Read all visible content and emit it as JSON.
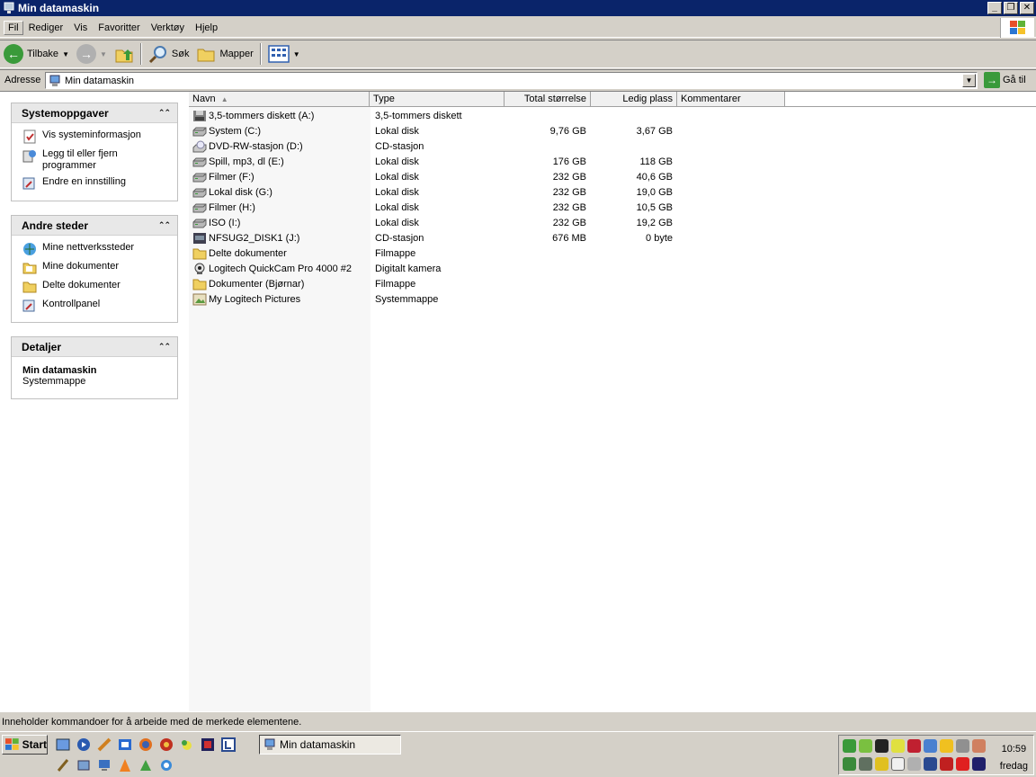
{
  "window": {
    "title": "Min datamaskin"
  },
  "menu": [
    "Fil",
    "Rediger",
    "Vis",
    "Favoritter",
    "Verktøy",
    "Hjelp"
  ],
  "toolbar": {
    "back": "Tilbake",
    "search": "Søk",
    "folders": "Mapper"
  },
  "address": {
    "label": "Adresse",
    "value": "Min datamaskin",
    "go": "Gå til"
  },
  "taskpane": {
    "system": {
      "title": "Systemoppgaver",
      "links": [
        "Vis systeminformasjon",
        "Legg til eller fjern programmer",
        "Endre en innstilling"
      ]
    },
    "other": {
      "title": "Andre steder",
      "links": [
        "Mine nettverkssteder",
        "Mine dokumenter",
        "Delte dokumenter",
        "Kontrollpanel"
      ]
    },
    "details": {
      "title": "Detaljer",
      "name": "Min datamaskin",
      "type": "Systemmappe"
    }
  },
  "columns": [
    "Navn",
    "Type",
    "Total størrelse",
    "Ledig plass",
    "Kommentarer"
  ],
  "items": [
    {
      "name": "3,5-tommers diskett (A:)",
      "type": "3,5-tommers diskett",
      "total": "",
      "free": "",
      "icon": "floppy-icon"
    },
    {
      "name": "System (C:)",
      "type": "Lokal disk",
      "total": "9,76 GB",
      "free": "3,67 GB",
      "icon": "hard-disk-icon"
    },
    {
      "name": "DVD-RW-stasjon (D:)",
      "type": "CD-stasjon",
      "total": "",
      "free": "",
      "icon": "cd-drive-icon"
    },
    {
      "name": "Spill, mp3, dl (E:)",
      "type": "Lokal disk",
      "total": "176 GB",
      "free": "118 GB",
      "icon": "hard-disk-icon"
    },
    {
      "name": "Filmer (F:)",
      "type": "Lokal disk",
      "total": "232 GB",
      "free": "40,6 GB",
      "icon": "hard-disk-icon"
    },
    {
      "name": "Lokal disk (G:)",
      "type": "Lokal disk",
      "total": "232 GB",
      "free": "19,0 GB",
      "icon": "hard-disk-icon"
    },
    {
      "name": "Filmer (H:)",
      "type": "Lokal disk",
      "total": "232 GB",
      "free": "10,5 GB",
      "icon": "hard-disk-icon"
    },
    {
      "name": "ISO (I:)",
      "type": "Lokal disk",
      "total": "232 GB",
      "free": "19,2 GB",
      "icon": "hard-disk-icon"
    },
    {
      "name": "NFSUG2_DISK1 (J:)",
      "type": "CD-stasjon",
      "total": "676 MB",
      "free": "0 byte",
      "icon": "game-cd-icon"
    },
    {
      "name": "Delte dokumenter",
      "type": "Filmappe",
      "total": "",
      "free": "",
      "icon": "folder-icon"
    },
    {
      "name": "Logitech QuickCam Pro 4000 #2",
      "type": "Digitalt kamera",
      "total": "",
      "free": "",
      "icon": "webcam-icon"
    },
    {
      "name": "Dokumenter (Bjørnar)",
      "type": "Filmappe",
      "total": "",
      "free": "",
      "icon": "folder-icon"
    },
    {
      "name": "My Logitech Pictures",
      "type": "Systemmappe",
      "total": "",
      "free": "",
      "icon": "pictures-folder-icon"
    }
  ],
  "status": "Inneholder kommandoer for å arbeide med de merkede elementene.",
  "taskbar": {
    "start": "Start",
    "active_window": "Min datamaskin",
    "clock_time": "10:59",
    "clock_day": "fredag"
  }
}
